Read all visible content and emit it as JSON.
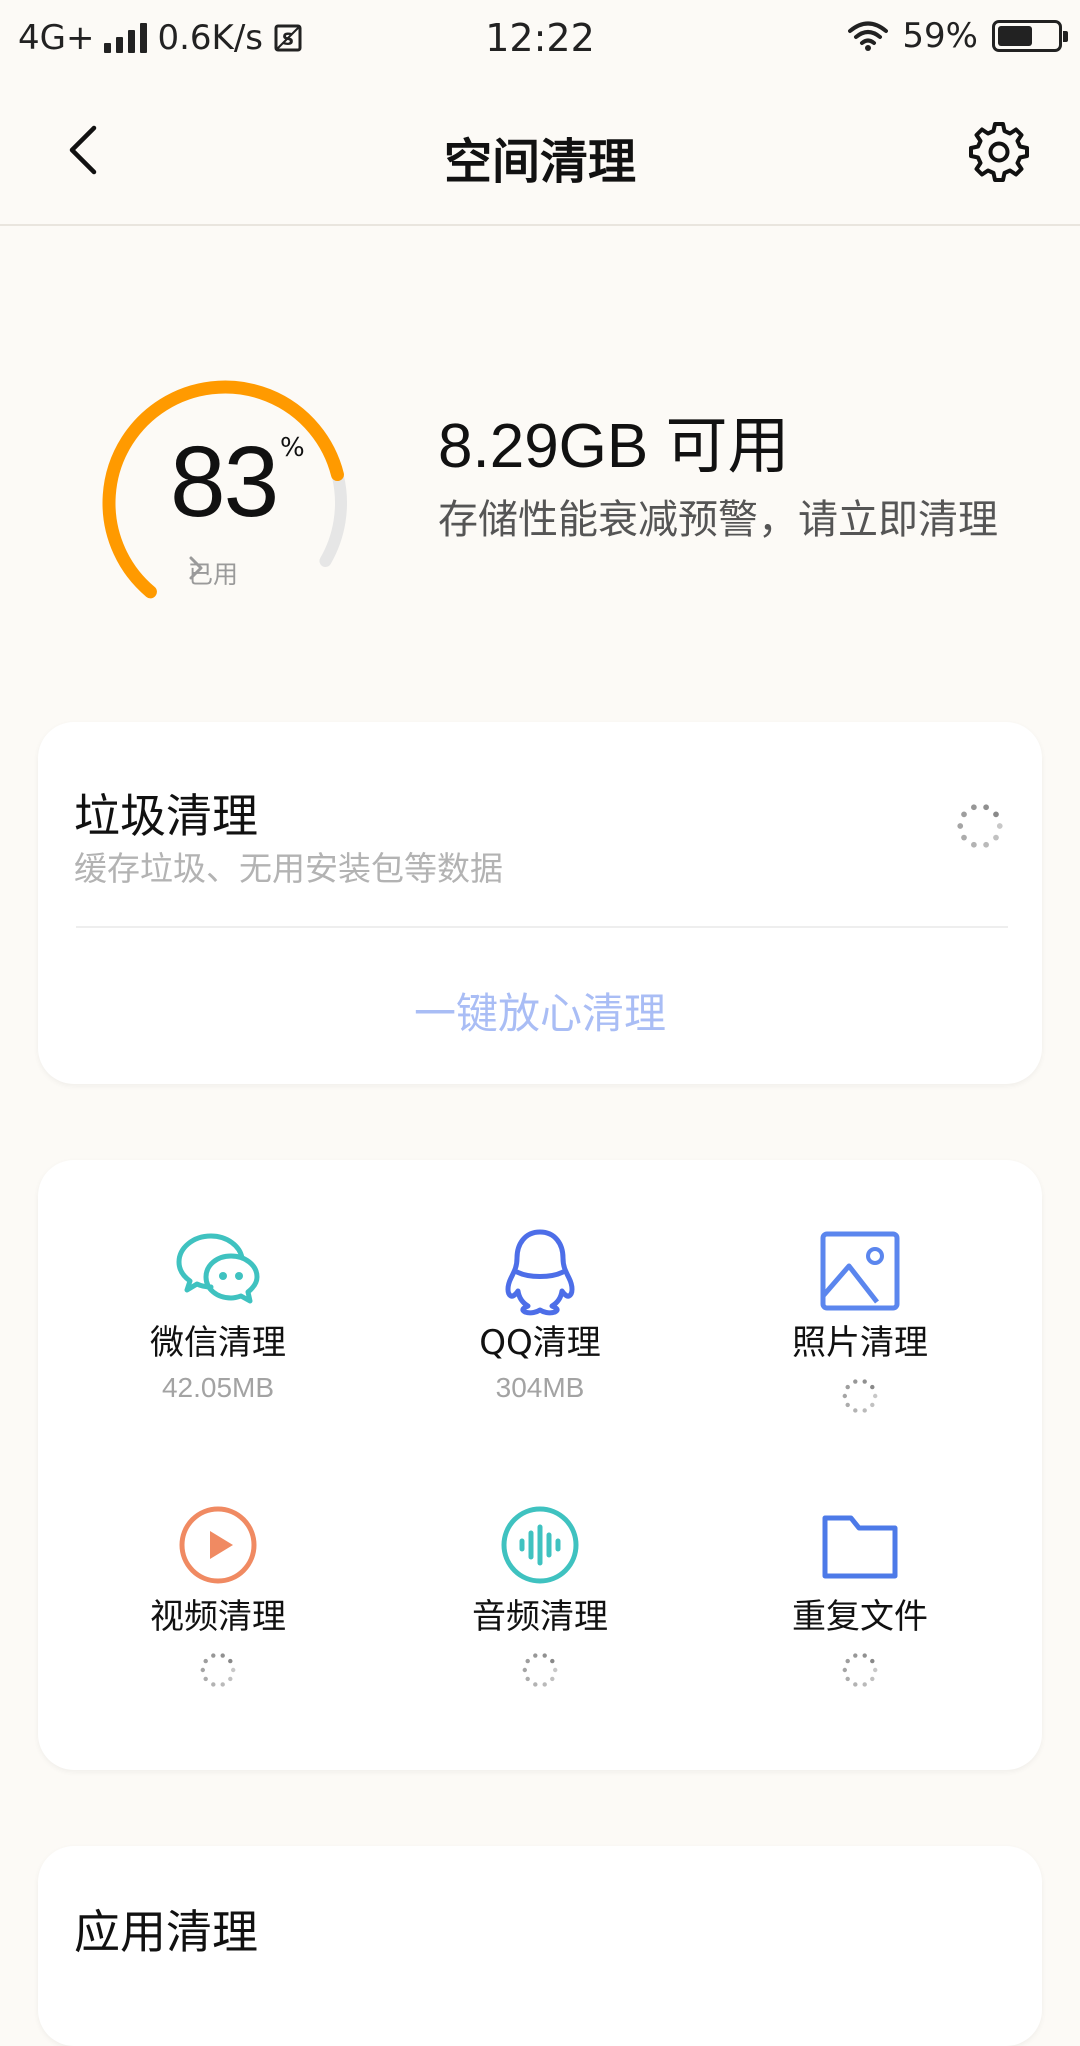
{
  "status_bar": {
    "network": "4G+",
    "speed": "0.6K/s",
    "time": "12:22",
    "battery_percent": "59%",
    "battery_level": 0.59,
    "icons": [
      "signal-icon",
      "screenshot-icon",
      "wifi-icon",
      "battery-icon"
    ]
  },
  "header": {
    "title": "空间清理",
    "back_icon": "chevron-left-icon",
    "settings_icon": "gear-icon"
  },
  "storage": {
    "used_percent_value": "83",
    "used_percent_unit": "%",
    "used_fraction": 0.83,
    "used_caption": "已用",
    "available": "8.29GB 可用",
    "warning": "存储性能衰减预警，请立即清理",
    "colors": {
      "used": "#ff9a00",
      "remaining": "#e6e6e6"
    }
  },
  "junk": {
    "title": "垃圾清理",
    "description": "缓存垃圾、无用安装包等数据",
    "action": "一键放心清理"
  },
  "tools": [
    {
      "label": "微信清理",
      "size": "42.05MB",
      "icon": "wechat-icon",
      "color": "#3fc2c0"
    },
    {
      "label": "QQ清理",
      "size": "304MB",
      "icon": "qq-penguin-icon",
      "color": "#4d6ee8"
    },
    {
      "label": "照片清理",
      "size": "",
      "icon": "photo-icon",
      "color": "#5b86ee"
    },
    {
      "label": "视频清理",
      "size": "",
      "icon": "video-play-icon",
      "color": "#f08a62"
    },
    {
      "label": "音频清理",
      "size": "",
      "icon": "audio-wave-icon",
      "color": "#3fc2c0"
    },
    {
      "label": "重复文件",
      "size": "",
      "icon": "folder-icon",
      "color": "#4d7ae8"
    }
  ],
  "app_clean": {
    "title": "应用清理"
  }
}
